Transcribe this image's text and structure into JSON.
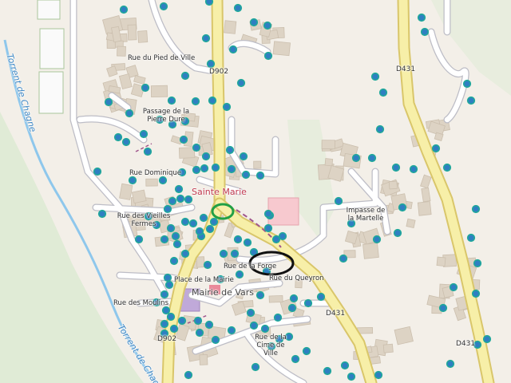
{
  "map": {
    "colors": {
      "background": "#f3efe8",
      "building": "#ddd3c4",
      "building_stroke": "#cbbfae",
      "minor_road": "#ffffff",
      "minor_road_casing": "#bdbdc6",
      "main_road": "#f7efa8",
      "main_road_casing": "#d9c66a",
      "water": "#8ec7ec",
      "green": "#cfe7c6",
      "marker_fill": "#2f7fc1",
      "marker_stroke": "#1fa89a",
      "pink_area": "#f7c9cf",
      "purple_area": "#c0a9d9",
      "town_hall": "#e98a9a"
    },
    "place_label": "Sainte Marie",
    "amenity_label": "Mairie de Vars",
    "streets": [
      "Rue du Pied de Ville",
      "Passage de la Pierre Dure",
      "Rue Dominique",
      "Rue des Vieilles Fermes",
      "Rue de la Forge",
      "Rue du Queyron",
      "Place de la Mairie",
      "Rue des Moulins",
      "Rue de la Cime de Ville",
      "Impasse de la Martelle"
    ],
    "routes": [
      "D902",
      "D431"
    ],
    "waterway": "Torrent de Chagne",
    "annotations": [
      {
        "shape": "ellipse",
        "color": "#22a045"
      },
      {
        "shape": "ellipse",
        "color": "#111111"
      }
    ],
    "marker_count": 150
  }
}
